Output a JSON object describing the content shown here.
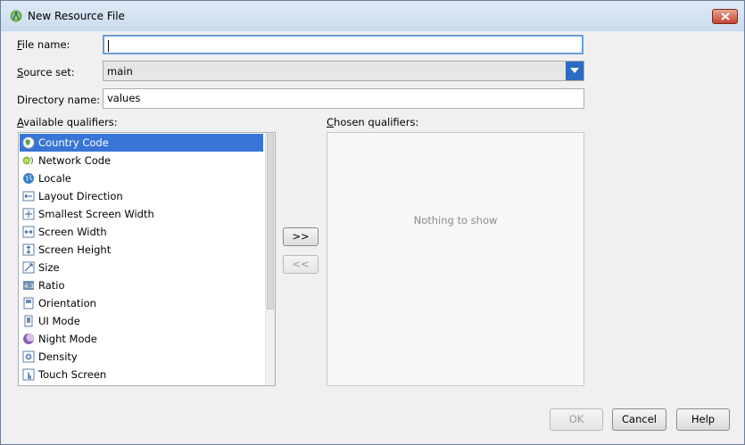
{
  "window": {
    "title": "New Resource File",
    "close_icon": "close-icon"
  },
  "form": {
    "file_name": {
      "label_u": "F",
      "label_rest": "ile name:",
      "value": ""
    },
    "source_set": {
      "label_u": "S",
      "label_rest": "ource set:",
      "value": "main"
    },
    "directory_name": {
      "label": "Directory name:",
      "value": "values"
    }
  },
  "available": {
    "label_u": "A",
    "label_rest": "vailable qualifiers:",
    "items": [
      {
        "label": "Country Code",
        "icon": "globe-icon"
      },
      {
        "label": "Network Code",
        "icon": "network-icon"
      },
      {
        "label": "Locale",
        "icon": "locale-icon"
      },
      {
        "label": "Layout Direction",
        "icon": "layout-direction-icon"
      },
      {
        "label": "Smallest Screen Width",
        "icon": "smallest-width-icon"
      },
      {
        "label": "Screen Width",
        "icon": "screen-width-icon"
      },
      {
        "label": "Screen Height",
        "icon": "screen-height-icon"
      },
      {
        "label": "Size",
        "icon": "size-icon"
      },
      {
        "label": "Ratio",
        "icon": "ratio-icon"
      },
      {
        "label": "Orientation",
        "icon": "orientation-icon"
      },
      {
        "label": "UI Mode",
        "icon": "ui-mode-icon"
      },
      {
        "label": "Night Mode",
        "icon": "night-mode-icon"
      },
      {
        "label": "Density",
        "icon": "density-icon"
      },
      {
        "label": "Touch Screen",
        "icon": "touch-screen-icon"
      }
    ],
    "selected_index": 0
  },
  "chosen": {
    "label_u": "C",
    "label_rest": "hosen qualifiers:",
    "empty_text": "Nothing to show"
  },
  "buttons": {
    "add": ">>",
    "remove": "<<",
    "ok": "OK",
    "cancel": "Cancel",
    "help": "Help"
  },
  "colors": {
    "selection": "#3875d7",
    "accent": "#2b6cc4"
  }
}
